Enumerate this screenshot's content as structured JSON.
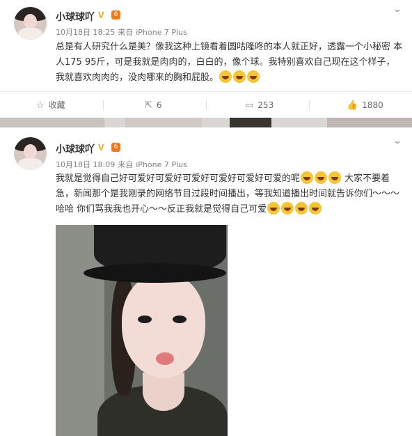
{
  "posts": [
    {
      "username": "小球球吖",
      "level": "6",
      "time": "10月18日 18:25",
      "source_prefix": "来自",
      "device": "iPhone 7 Plus",
      "text_part1": "总是有人研究什么是美？像我这种上镜看着圆咕隆咚的本人就正好，透露一个小秘密 本人175 95斤，可是我就是肉肉的，白白的，像个球。我特别喜欢自己现在这个样子，我就喜欢肉肉的，没肉哪来的胸和屁股。",
      "actions": {
        "favorite_label": "收藏",
        "repost_count": "6",
        "comment_count": "253",
        "like_count": "1880"
      }
    },
    {
      "username": "小球球吖",
      "level": "6",
      "time": "10月18日 18:09",
      "source_prefix": "来自",
      "device": "iPhone 7 Plus",
      "text_part1": "我就是觉得自己好可爱好可爱好可爱好可爱好可爱好可爱的呢",
      "text_part2": "大家不要着急，新闻那个是我刚录的网络节目过段时间播出，等我知道播出时间就告诉你们～～～哈哈 你们骂我我也开心～～反正我就是觉得自己可爱"
    }
  ],
  "icons": {
    "verified": "verified-v-icon",
    "level": "level-badge-icon",
    "more": "chevron-down-icon",
    "favorite": "star-icon",
    "repost": "repost-icon",
    "comment": "comment-icon",
    "like": "thumbs-up-icon",
    "emoji": "laughing-tears-emoji"
  },
  "colors": {
    "verified": "#f7a500",
    "level": "#f07a1b",
    "meta_text": "#808080",
    "background_gap": "#e9e9e9"
  }
}
